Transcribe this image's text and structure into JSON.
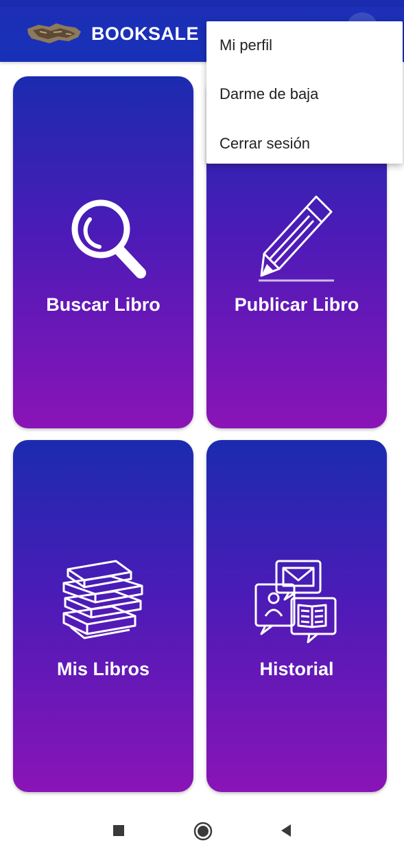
{
  "app": {
    "title": "BOOKSALE"
  },
  "colors": {
    "appbar": "#1c2fb6",
    "tile_top": "#1b2bb0",
    "tile_bottom": "#8a14b7"
  },
  "tiles": [
    {
      "label": "Buscar Libro",
      "icon": "search-icon"
    },
    {
      "label": "Publicar Libro",
      "icon": "pencil-icon"
    },
    {
      "label": "Mis Libros",
      "icon": "books-stack-icon"
    },
    {
      "label": "Historial",
      "icon": "history-messages-icon"
    }
  ],
  "menu": {
    "items": [
      "Mi perfil",
      "Darme de baja",
      "Cerrar sesión"
    ]
  },
  "navbar": {
    "buttons": [
      "recent-apps-icon",
      "home-icon",
      "back-icon"
    ]
  }
}
